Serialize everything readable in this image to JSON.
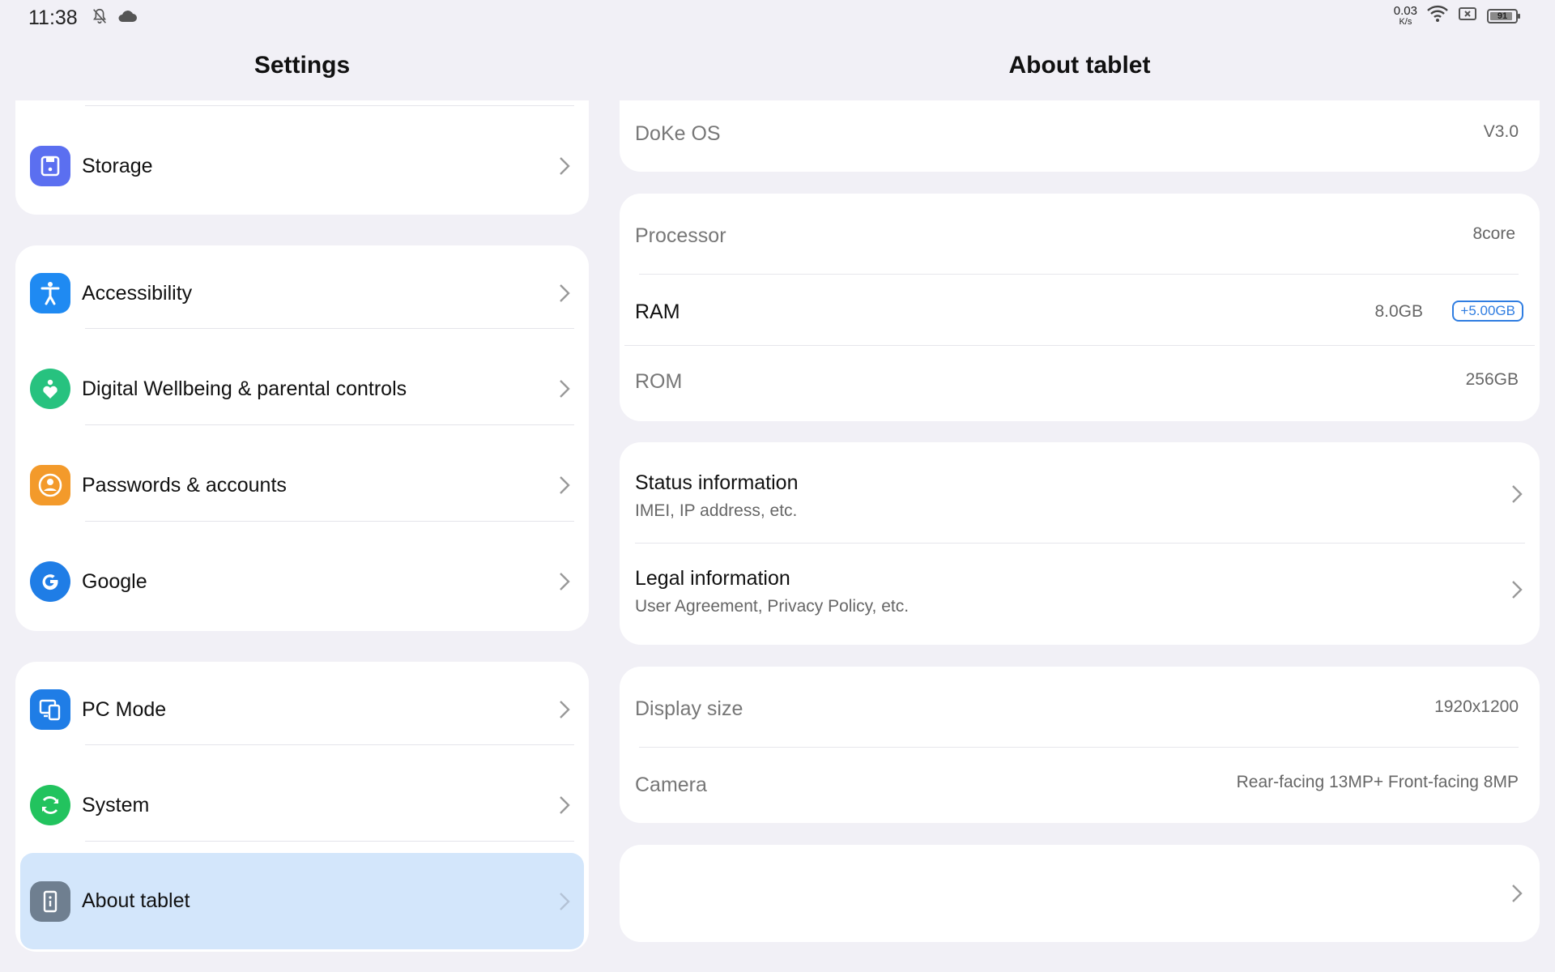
{
  "status_bar": {
    "time": "11:38",
    "left_icons": [
      "bell-off-icon",
      "cloud-icon"
    ],
    "net_speed_value": "0.03",
    "net_speed_unit": "K/s",
    "right_icons": [
      "wifi-icon",
      "no-sim-icon",
      "battery-icon"
    ],
    "battery_level": "91",
    "battery_fraction": 0.91
  },
  "left_panel": {
    "title": "Settings",
    "items": [
      {
        "label": "Storage",
        "icon": "storage-icon",
        "color": "#5b6ff0"
      },
      {
        "label": "Accessibility",
        "icon": "accessibility-icon",
        "color": "#1f8af2"
      },
      {
        "label": "Digital Wellbeing & parental controls",
        "icon": "wellbeing-heart-icon",
        "color": "#27c27f"
      },
      {
        "label": "Passwords & accounts",
        "icon": "account-icon",
        "color": "#f39a2b"
      },
      {
        "label": "Google",
        "icon": "google-g-icon",
        "color": "#1f7de6"
      },
      {
        "label": "PC Mode",
        "icon": "pc-mode-icon",
        "color": "#1f7de6"
      },
      {
        "label": "System",
        "icon": "system-sync-icon",
        "color": "#22c35e"
      },
      {
        "label": "About tablet",
        "icon": "about-tablet-icon",
        "color": "#6f7f90"
      }
    ],
    "selected_item": "About tablet"
  },
  "right_panel": {
    "title": "About tablet",
    "os": {
      "label": "DoKe OS",
      "value": "V3.0"
    },
    "hardware": {
      "processor": {
        "label": "Processor",
        "value": "8core"
      },
      "ram": {
        "label": "RAM",
        "value": "8.0GB",
        "badge": "+5.00GB"
      },
      "rom": {
        "label": "ROM",
        "value": "256GB"
      }
    },
    "info": {
      "status": {
        "title": "Status information",
        "subtitle": "IMEI, IP address, etc."
      },
      "legal": {
        "title": "Legal information",
        "subtitle": "User Agreement, Privacy Policy, etc."
      }
    },
    "display": {
      "size": {
        "label": "Display size",
        "value": "1920x1200"
      },
      "camera": {
        "label": "Camera",
        "value": "Rear-facing 13MP+ Front-facing 8MP"
      }
    }
  },
  "colors": {
    "background": "#f1f0f6",
    "card": "#ffffff",
    "selected": "#d3e6fb",
    "accent": "#2f7de1"
  }
}
